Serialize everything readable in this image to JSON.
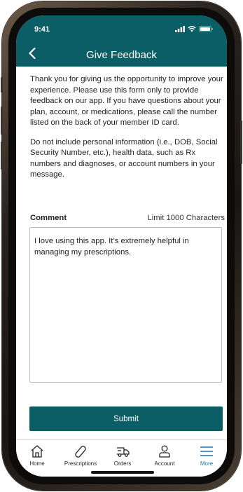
{
  "status_bar": {
    "time": "9:41"
  },
  "header": {
    "title": "Give Feedback",
    "back_icon": "chevron-left-icon"
  },
  "intro": {
    "paragraph1": "Thank you for giving us the opportunity to improve your experience. Please use this form only to provide feedback on our app. If you have questions about your plan, account, or medications, please call the number listed on the back of your member ID card.",
    "paragraph2": "Do not include personal information (i.e., DOB, Social Security Number, etc.), health data, such as Rx numbers and diagnoses, or account numbers in your message."
  },
  "comment": {
    "label": "Comment",
    "limit": "Limit 1000 Characters",
    "value": "I love using this app. It’s extremely helpful in managing my prescriptions."
  },
  "submit": {
    "label": "Submit"
  },
  "tabbar": {
    "items": [
      {
        "label": "Home",
        "icon": "home-icon"
      },
      {
        "label": "Prescriptions",
        "icon": "pill-icon"
      },
      {
        "label": "Orders",
        "icon": "truck-icon"
      },
      {
        "label": "Account",
        "icon": "person-icon"
      },
      {
        "label": "More",
        "icon": "menu-icon",
        "active": true
      }
    ]
  },
  "colors": {
    "brand": "#0b5e66",
    "active_tab": "#1a73b8"
  }
}
